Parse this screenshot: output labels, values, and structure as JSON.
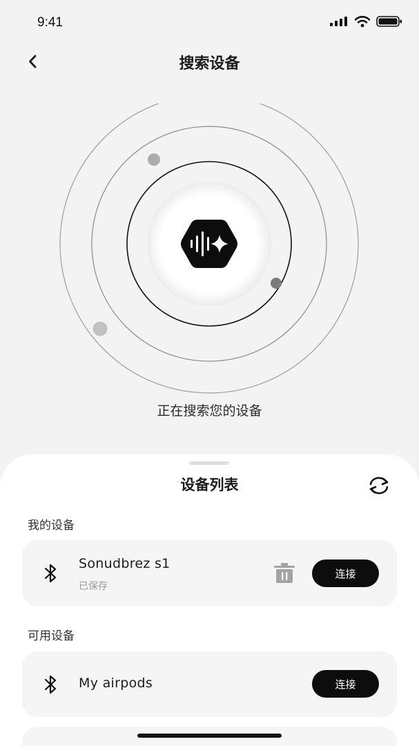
{
  "status_bar": {
    "time": "9:41"
  },
  "header": {
    "title": "搜索设备"
  },
  "search": {
    "status_text": "正在搜索您的设备"
  },
  "device_sheet": {
    "title": "设备列表",
    "my_devices": {
      "label": "我的设备",
      "items": [
        {
          "name": "Sonudbrez s1",
          "status": "已保存",
          "connect_label": "连接"
        }
      ]
    },
    "available_devices": {
      "label": "可用设备",
      "items": [
        {
          "name": "My airpods",
          "connect_label": "连接"
        }
      ]
    }
  },
  "icons": {
    "back": "chevron-left-icon",
    "refresh": "refresh-icon",
    "bluetooth": "bluetooth-icon",
    "delete": "trash-icon",
    "logo": "soundwave-sparkle-icon"
  },
  "colors": {
    "background": "#f3f3f3",
    "sheet": "#ffffff",
    "card": "#f5f5f5",
    "button": "#0d0d0d",
    "muted": "#9a9a9a"
  }
}
